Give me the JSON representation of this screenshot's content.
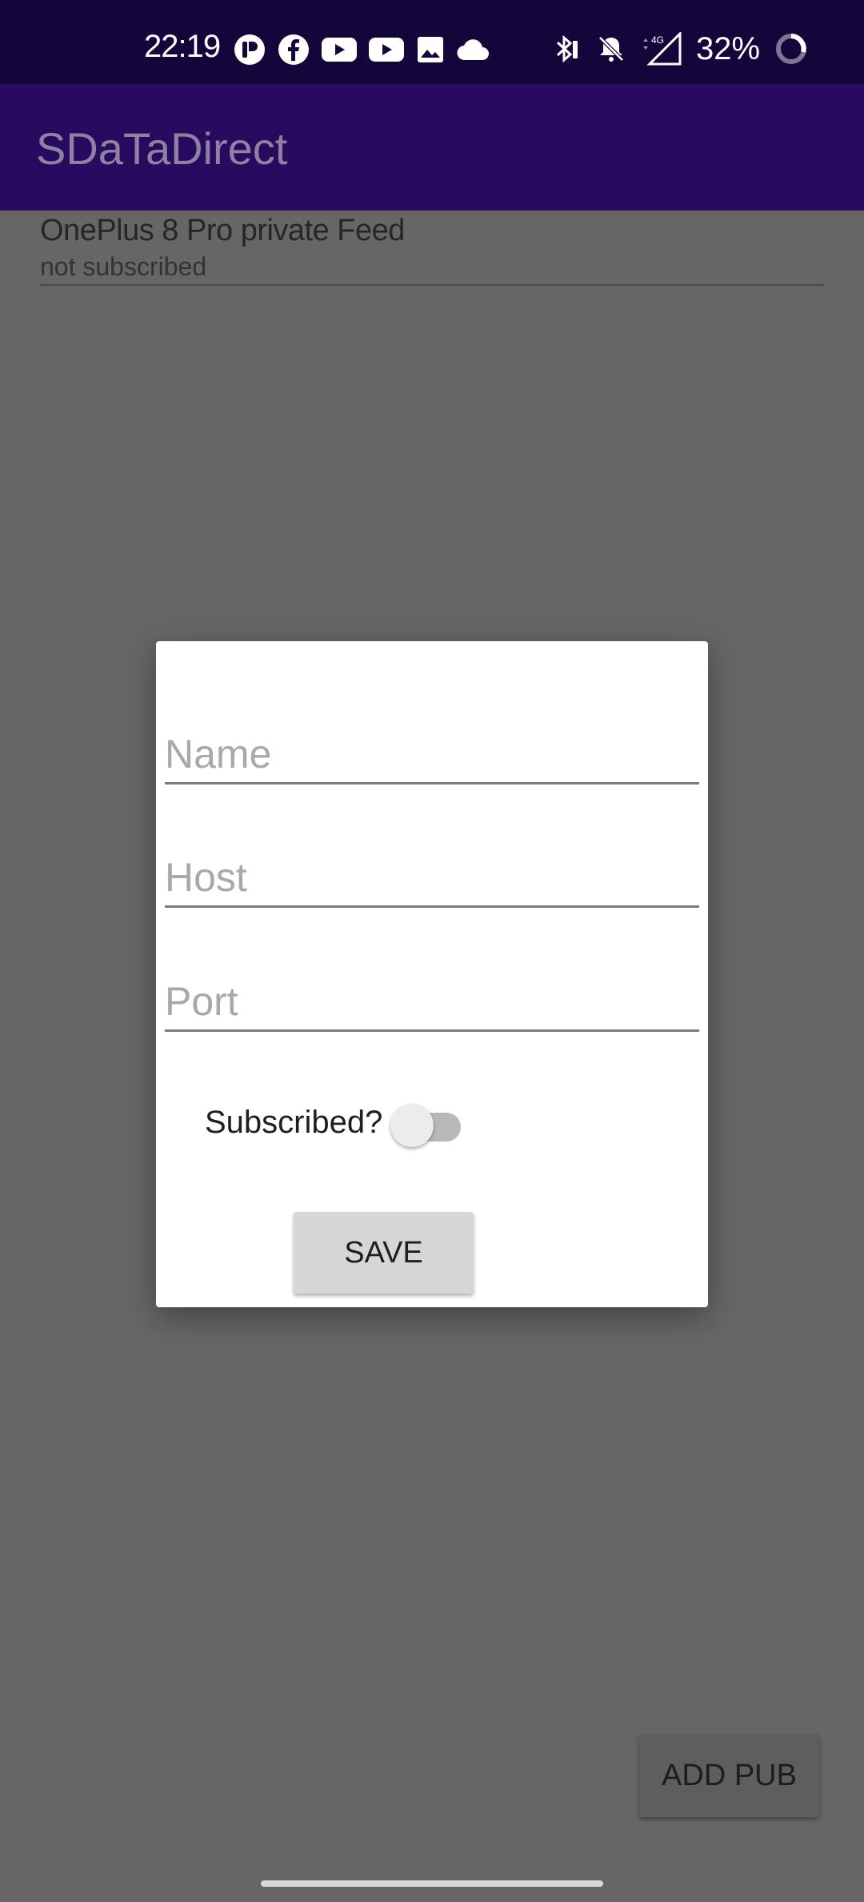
{
  "status_bar": {
    "time": "22:19",
    "battery": "32%",
    "left_icons": [
      "app-p-icon",
      "facebook-icon",
      "youtube-icon",
      "youtube-icon",
      "gallery-icon",
      "cloud-icon"
    ],
    "right_icons": [
      "bluetooth-icon",
      "bell-off-icon",
      "signal-4g-icon",
      "battery-ring-icon"
    ]
  },
  "app_bar": {
    "title": "SDaTaDirect"
  },
  "feed_list": {
    "items": [
      {
        "title": "OnePlus 8 Pro private Feed",
        "subtitle": "not subscribed"
      }
    ]
  },
  "dialog": {
    "name_placeholder": "Name",
    "host_placeholder": "Host",
    "port_placeholder": "Port",
    "subscribed_label": "Subscribed?",
    "subscribed": false,
    "save_label": "SAVE"
  },
  "fab": {
    "add_pub_label": "ADD PUB"
  },
  "colors": {
    "status_bar": "#14063a",
    "app_bar": "#280a5e",
    "scrim_background": "#666666",
    "dialog": "#ffffff"
  }
}
